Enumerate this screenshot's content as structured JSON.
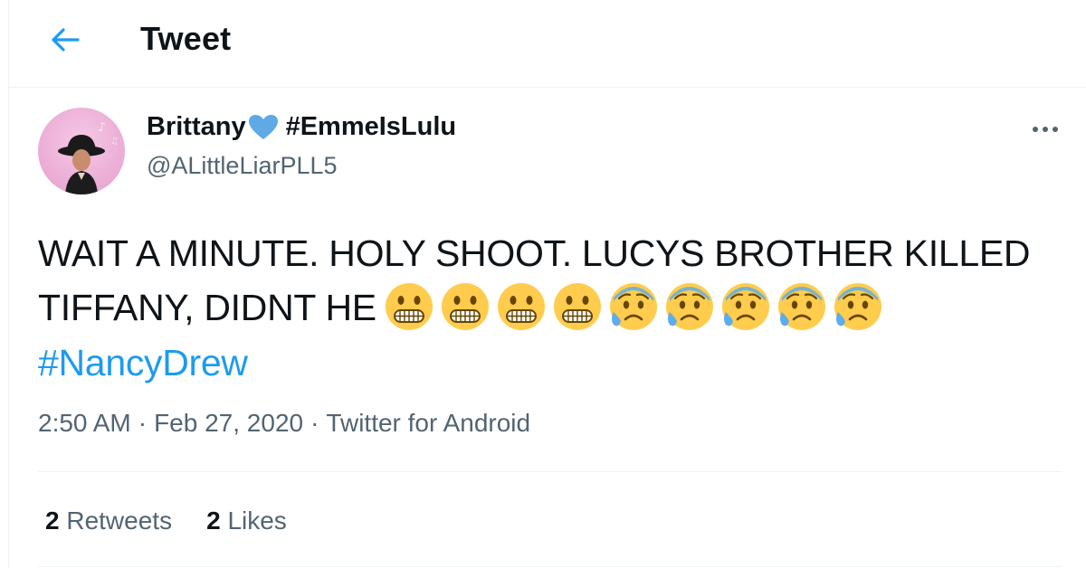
{
  "header": {
    "title": "Tweet",
    "back_icon": "arrow-left-icon"
  },
  "author": {
    "display_name": "Brittany",
    "name_suffix": "#EmmeIsLulu",
    "handle": "@ALittleLiarPLL5",
    "heart_color": "#5ea9e6",
    "avatar": "avatar"
  },
  "tweet": {
    "text_line": "WAIT A MINUTE. HOLY SHOOT. LUCYS BROTHER KILLED TIFFANY, DIDNT HE",
    "emojis": [
      "grimacing-face",
      "grimacing-face",
      "grimacing-face",
      "grimacing-face",
      "anxious-face-with-sweat",
      "anxious-face-with-sweat",
      "anxious-face-with-sweat",
      "anxious-face-with-sweat",
      "anxious-face-with-sweat"
    ],
    "hashtag": "#NancyDrew",
    "hashtag_color": "#1d9bf0"
  },
  "meta": {
    "time": "2:50 AM",
    "date": "Feb 27, 2020",
    "source": "Twitter for Android",
    "separator": "·"
  },
  "stats": {
    "retweets_count": "2",
    "retweets_label": "Retweets",
    "likes_count": "2",
    "likes_label": "Likes"
  },
  "colors": {
    "secondary_text": "#536471",
    "accent": "#1d9bf0",
    "divider": "#eff3f4"
  }
}
